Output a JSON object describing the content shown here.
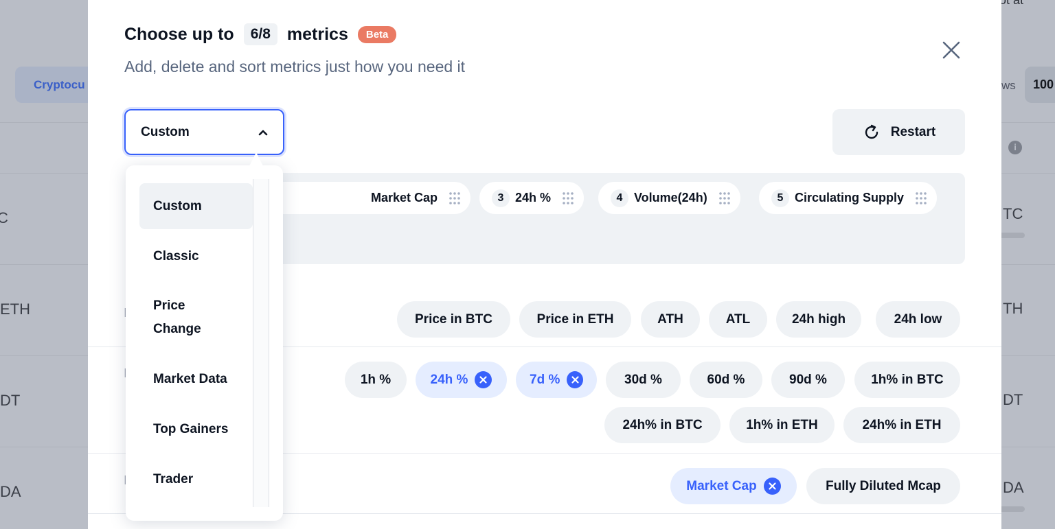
{
  "background": {
    "tab_label": "Cryptocu",
    "rows_label": "ws",
    "rows_value": "100",
    "top_right_text": "p not at ",
    "row_symbols_left": [
      "C",
      "ETH",
      "DT",
      "DA"
    ],
    "row_symbols_right": [
      "TC",
      "TH",
      "DT",
      "DA"
    ]
  },
  "modal": {
    "title_prefix": "Choose up to",
    "count": "6/8",
    "title_suffix": "metrics",
    "badge": "Beta",
    "subtitle": "Add, delete and sort metrics just how you need it",
    "close_icon": "close-icon",
    "preset_select": {
      "value": "Custom"
    },
    "restart_label": "Restart",
    "selected_metrics": [
      {
        "num": "",
        "label": "Market Cap"
      },
      {
        "num": "3",
        "label": "24h %"
      },
      {
        "num": "4",
        "label": "Volume(24h)"
      },
      {
        "num": "5",
        "label": "Circulating Supply"
      }
    ],
    "price_metrics": [
      "Price in BTC",
      "Price in ETH",
      "ATH",
      "ATL",
      "24h high",
      "24h low"
    ],
    "change_metrics_row1": [
      {
        "label": "1h %",
        "selected": false
      },
      {
        "label": "24h %",
        "selected": true
      },
      {
        "label": "7d %",
        "selected": true
      },
      {
        "label": "30d %",
        "selected": false
      },
      {
        "label": "60d %",
        "selected": false
      },
      {
        "label": "90d %",
        "selected": false
      },
      {
        "label": "1h% in BTC",
        "selected": false
      }
    ],
    "change_metrics_row2": [
      "24h% in BTC",
      "1h% in ETH",
      "24h% in ETH"
    ],
    "market_metrics": [
      {
        "label": "Market Cap",
        "selected": true
      },
      {
        "label": "Fully Diluted Mcap",
        "selected": false
      }
    ]
  },
  "dropdown": {
    "items": [
      "Custom",
      "Classic",
      "Price Change",
      "Market Data",
      "Top Gainers",
      "Trader"
    ],
    "selected_index": 0
  },
  "colors": {
    "accent": "#3861fb",
    "badge": "#ea7a63",
    "chip_bg": "#eff2f5",
    "chip_selected_bg": "#e5edff"
  }
}
